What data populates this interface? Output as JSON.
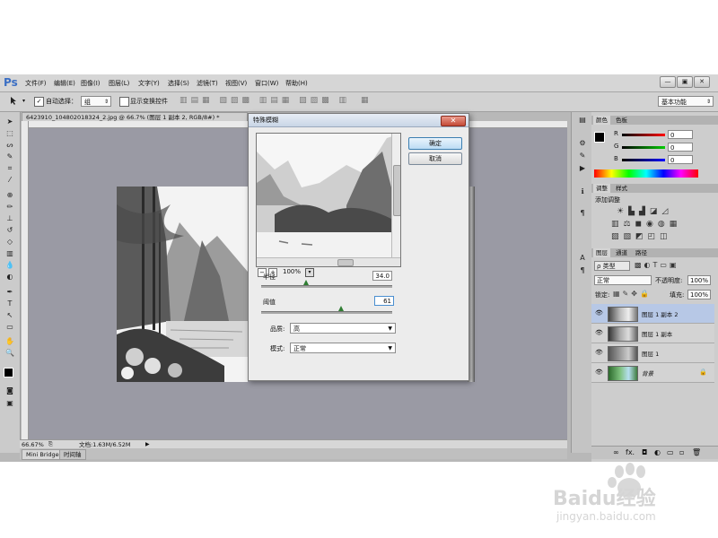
{
  "app": {
    "logo": "Ps"
  },
  "menu": [
    "文件(F)",
    "编辑(E)",
    "图像(I)",
    "图层(L)",
    "文字(Y)",
    "选择(S)",
    "滤镜(T)",
    "视图(V)",
    "窗口(W)",
    "帮助(H)"
  ],
  "window_controls": {
    "minimize": "—",
    "restore": "▣",
    "close": "✕"
  },
  "options_bar": {
    "auto_select_label": "自动选择：",
    "auto_select_value": "组",
    "show_transform_label": "显示变换控件",
    "workspace": "基本功能"
  },
  "document": {
    "tab_title": "6423910_104802018324_2.jpg @ 66.7% (图层 1 副本 2, RGB/8#) *",
    "zoom": "66.67%",
    "doc_size": "文档:1.63M/6.52M"
  },
  "bottom_tabs": [
    "Mini Bridge",
    "时间轴"
  ],
  "dialog": {
    "title": "特殊模糊",
    "close": "✕",
    "ok": "确定",
    "cancel": "取消",
    "preview_zoom": "100%",
    "radius_label": "半径",
    "radius_value": "34.0",
    "radius_fraction": 0.34,
    "threshold_label": "阈值",
    "threshold_value": "61",
    "threshold_fraction": 0.61,
    "quality_label": "品质:",
    "quality_value": "高",
    "mode_label": "模式:",
    "mode_value": "正常"
  },
  "color_panel": {
    "tabs": [
      "颜色",
      "色板"
    ],
    "r_label": "R",
    "r_value": "0",
    "g_label": "G",
    "g_value": "0",
    "b_label": "B",
    "b_value": "0"
  },
  "adjust_panel": {
    "tabs": [
      "调整",
      "样式"
    ],
    "heading": "添加调整"
  },
  "layers_panel": {
    "tabs": [
      "图层",
      "通道",
      "路径"
    ],
    "filter_label": "ρ 类型",
    "blend_mode": "正常",
    "opacity_label": "不透明度:",
    "opacity_value": "100%",
    "lock_label": "锁定:",
    "fill_label": "填充:",
    "fill_value": "100%",
    "layers": [
      {
        "name": "图层 1 副本 2",
        "selected": true,
        "eye": "👁"
      },
      {
        "name": "图层 1 副本",
        "selected": false,
        "eye": "👁"
      },
      {
        "name": "图层 1",
        "selected": false,
        "eye": "👁"
      },
      {
        "name": "背景",
        "selected": false,
        "eye": "👁",
        "lock": "🔒"
      }
    ],
    "footer_icons": [
      "link-icon",
      "fx-icon",
      "mask-icon",
      "adjustment-icon",
      "folder-icon",
      "new-layer-icon",
      "trash-icon"
    ],
    "footer_glyphs": [
      "∞",
      "fx.",
      "◘",
      "◐",
      "▭",
      "▫",
      "🗑"
    ]
  },
  "colors": {
    "accent": "#3b6fc4",
    "canvas": "#9a9aa4",
    "selection": "#b7c8e6"
  },
  "watermark": {
    "brand": "Baidu经验",
    "url": "jingyan.baidu.com"
  }
}
